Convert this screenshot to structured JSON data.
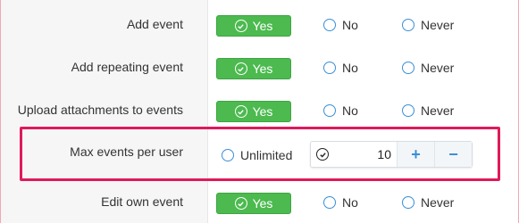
{
  "rows": [
    {
      "label": "Add event",
      "yes": "Yes",
      "no": "No",
      "never": "Never"
    },
    {
      "label": "Add repeating event",
      "yes": "Yes",
      "no": "No",
      "never": "Never"
    },
    {
      "label": "Upload attachments to events",
      "yes": "Yes",
      "no": "No",
      "never": "Never"
    },
    {
      "label": "Max events per user",
      "unlimited": "Unlimited",
      "value": "10",
      "plus": "+",
      "minus": "−"
    },
    {
      "label": "Edit own event",
      "yes": "Yes",
      "no": "No",
      "never": "Never"
    }
  ],
  "colors": {
    "yes_button": "#4cba4f",
    "radio_border": "#3a8fd6",
    "highlight": "#e0195a"
  },
  "icons": {
    "yes": "check-circle-icon",
    "stepper": "check-circle-icon"
  }
}
